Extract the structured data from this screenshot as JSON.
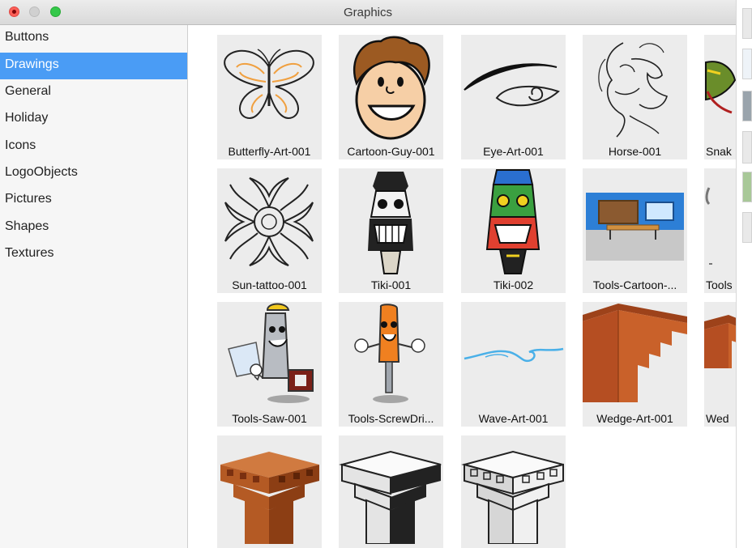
{
  "window": {
    "title": "Graphics"
  },
  "sidebar": {
    "items": [
      {
        "label": "Buttons"
      },
      {
        "label": "Drawings"
      },
      {
        "label": "General"
      },
      {
        "label": "Holiday"
      },
      {
        "label": "Icons"
      },
      {
        "label": "LogoObjects"
      },
      {
        "label": "Pictures"
      },
      {
        "label": "Shapes"
      },
      {
        "label": "Textures"
      }
    ],
    "selected": "Drawings"
  },
  "gallery": {
    "items": [
      {
        "label": "Butterfly-Art-001",
        "icon": "butterfly-art"
      },
      {
        "label": "Cartoon-Guy-001",
        "icon": "cartoon-guy"
      },
      {
        "label": "Eye-Art-001",
        "icon": "eye-art"
      },
      {
        "label": "Horse-001",
        "icon": "horse-art"
      },
      {
        "label": "Snak",
        "icon": "snake-art"
      },
      {
        "label": "Sun-tattoo-001",
        "icon": "sun-tattoo"
      },
      {
        "label": "Tiki-001",
        "icon": "tiki-mask"
      },
      {
        "label": "Tiki-002",
        "icon": "tiki-mask-color"
      },
      {
        "label": "Tools-Cartoon-...",
        "icon": "tools-cartoon"
      },
      {
        "label": "Tools",
        "icon": "tools"
      },
      {
        "label": "Tools-Saw-001",
        "icon": "saw-cartoon"
      },
      {
        "label": "Tools-ScrewDri...",
        "icon": "screwdriver-cartoon"
      },
      {
        "label": "Wave-Art-001",
        "icon": "wave-art"
      },
      {
        "label": "Wedge-Art-001",
        "icon": "wedge-art"
      },
      {
        "label": "Wed",
        "icon": "wedge-art"
      },
      {
        "label": "",
        "icon": "column-capital-brown"
      },
      {
        "label": "",
        "icon": "column-capital-gray"
      },
      {
        "label": "",
        "icon": "column-capital-gray-ornate"
      }
    ]
  }
}
